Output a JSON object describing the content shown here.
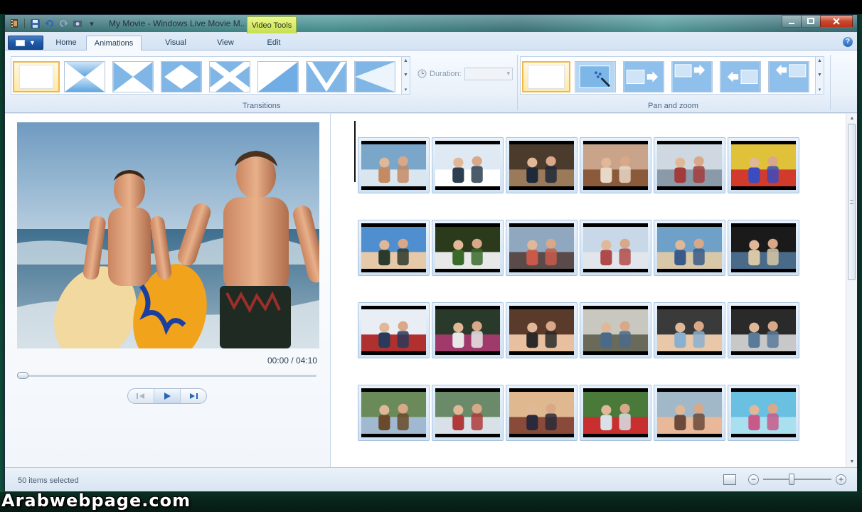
{
  "window": {
    "title": "My Movie - Windows Live Movie M...",
    "context_tab_group": "Video Tools"
  },
  "quick_access": {
    "icons": [
      "movie-maker-icon",
      "save-icon",
      "undo-icon",
      "redo-icon",
      "snapshot-icon",
      "customize-icon"
    ]
  },
  "tabs": [
    {
      "label": "Home",
      "active": false
    },
    {
      "label": "Animations",
      "active": true
    },
    {
      "label": "Visual Effects",
      "active": false
    },
    {
      "label": "View",
      "active": false
    },
    {
      "label": "Edit",
      "active": false
    }
  ],
  "ribbon": {
    "transitions_label": "Transitions",
    "transitions": [
      "none",
      "cross-diagonal",
      "bowtie-horizontal",
      "diamond",
      "cross-x",
      "wipe-diagonal",
      "chevron-down",
      "wedge-left"
    ],
    "duration_label": "Duration:",
    "duration_value": "",
    "pan_zoom_label": "Pan and zoom",
    "pan_zoom_items": [
      "none",
      "automatic",
      "pan-right",
      "pan-up-right",
      "pan-left",
      "pan-up-left"
    ]
  },
  "preview": {
    "time_readout": "00:00 / 04:10",
    "seek_position_fraction": 0.0
  },
  "storyboard": {
    "rows": [
      [
        "beach",
        "snow",
        "office",
        "party",
        "group",
        "bouncy"
      ],
      [
        "sunglasses",
        "garden",
        "skyline",
        "couple",
        "beach-group",
        "night"
      ],
      [
        "snow-family",
        "family",
        "women",
        "canyon",
        "selfie",
        "car"
      ],
      [
        "horses",
        "trampoline",
        "women-sunset",
        "soccer",
        "girl-face",
        "pool"
      ],
      [
        "partial",
        "partial",
        "partial",
        "partial",
        "partial",
        "partial"
      ]
    ]
  },
  "status": {
    "selection_text": "50 items selected",
    "zoom_level_fraction": 0.4
  },
  "watermark": {
    "text": "Arabwebpage.com"
  },
  "colors": {
    "accent_blue": "#2a64b3",
    "selection_gold": "#f0b74a",
    "context_tab_green": "#c6df4f"
  }
}
